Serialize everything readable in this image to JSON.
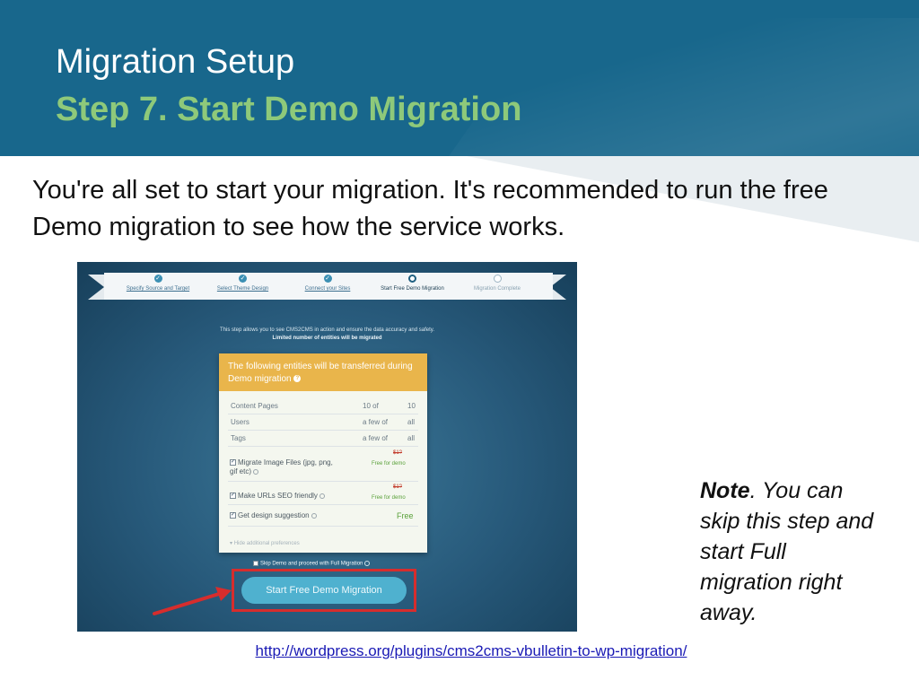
{
  "slide": {
    "title": "Migration Setup",
    "subtitle": "Step 7. Start Demo Migration",
    "intro": "You're all set to start your migration. It's recommended to run the free Demo migration to see how the service works.",
    "note_bold": "Note",
    "note_text": ". You can skip this step and start Full migration right away.",
    "link": "http://wordpress.org/plugins/cms2cms-vbulletin-to-wp-migration/",
    "colors": {
      "header": "#18678c",
      "subtitle": "#8ec97a",
      "link": "#1a1ab5"
    }
  },
  "screenshot": {
    "steps": [
      {
        "label": "Specify Source and Target",
        "status": "done"
      },
      {
        "label": "Select Theme Design",
        "status": "done"
      },
      {
        "label": "Connect your Sites",
        "status": "done"
      },
      {
        "label": "Start Free Demo Migration",
        "status": "current"
      },
      {
        "label": "Migration Complete",
        "status": "pending"
      }
    ],
    "info_line": "This step allows you to see CMS2CMS in action and ensure the data accuracy and safety.",
    "info_bold": "Limited number of entities will be migrated",
    "card_title": "The following entities will be transferred during Demo migration",
    "entities": [
      {
        "name": "Content Pages",
        "demo": "10 of",
        "total": "10"
      },
      {
        "name": "Users",
        "demo": "a few of",
        "total": "all"
      },
      {
        "name": "Tags",
        "demo": "a few of",
        "total": "all"
      }
    ],
    "options": [
      {
        "label": "Migrate Image Files (jpg, png, gif etc)",
        "old_price": "$1?",
        "price": "Free for demo"
      },
      {
        "label": "Make URLs SEO friendly",
        "old_price": "$1?",
        "price": "Free for demo"
      },
      {
        "label": "Get design suggestion",
        "price": "Free"
      }
    ],
    "hide_link": "Hide additional preferences",
    "skip_label": "Skip Demo and proceed with Full Migration",
    "button_label": "Start Free Demo Migration",
    "colors": {
      "card_header": "#e9b54b",
      "button": "#4fb1cf",
      "highlight": "#d62d2d"
    }
  }
}
